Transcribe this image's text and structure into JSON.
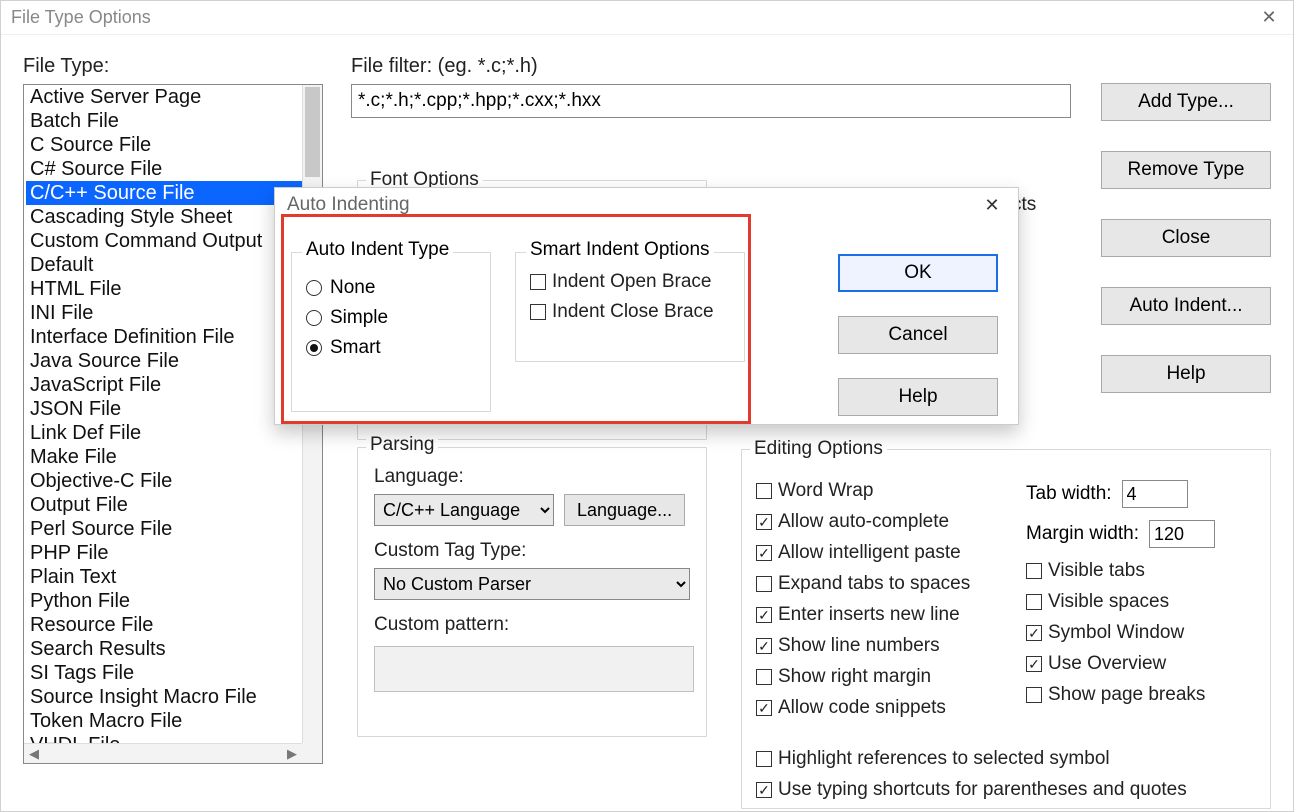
{
  "window": {
    "title": "File Type Options"
  },
  "file_type": {
    "label": "File Type:",
    "selected_index": 4,
    "items": [
      "Active Server Page",
      "Batch File",
      "C Source File",
      "C# Source File",
      "C/C++ Source File",
      "Cascading Style Sheet",
      "Custom Command Output",
      "Default",
      "HTML File",
      "INI File",
      "Interface Definition File",
      "Java Source File",
      "JavaScript File",
      "JSON File",
      "Link Def File",
      "Make File",
      "Objective-C File",
      "Output File",
      "Perl Source File",
      "PHP File",
      "Plain Text",
      "Python File",
      "Resource File",
      "Search Results",
      "SI Tags File",
      "Source Insight Macro File",
      "Token Macro File",
      "VHDL File"
    ]
  },
  "filter": {
    "label": "File filter: (eg. *.c;*.h)",
    "value": "*.c;*.h;*.cpp;*.hpp;*.cxx;*.hxx"
  },
  "font_options": {
    "label": "Font Options"
  },
  "include_projects": {
    "label": "Include when adding to projects",
    "checked": true
  },
  "parsing": {
    "label": "Parsing",
    "language_label": "Language:",
    "language_value": "C/C++ Language",
    "language_btn": "Language...",
    "custom_tag_label": "Custom Tag Type:",
    "custom_tag_value": "No Custom Parser",
    "custom_pattern_label": "Custom pattern:"
  },
  "editing": {
    "label": "Editing Options",
    "tab_width_label": "Tab width:",
    "tab_width_value": "4",
    "margin_width_label": "Margin width:",
    "margin_width_value": "120",
    "opts_a": [
      {
        "label": "Word Wrap",
        "checked": false
      },
      {
        "label": "Allow auto-complete",
        "checked": true
      },
      {
        "label": "Allow intelligent paste",
        "checked": true
      },
      {
        "label": "Expand tabs to spaces",
        "checked": false
      },
      {
        "label": "Enter inserts new line",
        "checked": true
      },
      {
        "label": "Show line numbers",
        "checked": true
      },
      {
        "label": "Show right margin",
        "checked": false
      },
      {
        "label": "Allow code snippets",
        "checked": true
      }
    ],
    "opts_b": [
      {
        "label": "Visible tabs",
        "checked": false
      },
      {
        "label": "Visible spaces",
        "checked": false
      },
      {
        "label": "Symbol Window",
        "checked": true
      },
      {
        "label": "Use Overview",
        "checked": true
      },
      {
        "label": "Show page breaks",
        "checked": false
      }
    ],
    "wide": [
      {
        "label": "Highlight references to selected symbol",
        "checked": false
      },
      {
        "label": "Use typing shortcuts for parentheses and quotes",
        "checked": true
      }
    ]
  },
  "side_buttons": {
    "add": "Add Type...",
    "remove": "Remove Type",
    "close": "Close",
    "auto_indent": "Auto Indent...",
    "help": "Help"
  },
  "auto_indent": {
    "title": "Auto Indenting",
    "type_group": "Auto Indent Type",
    "smart_group": "Smart Indent Options",
    "radios": [
      {
        "label": "None"
      },
      {
        "label": "Simple"
      },
      {
        "label": "Smart"
      }
    ],
    "radio_selected": 2,
    "smart_checks": [
      {
        "label": "Indent Open Brace",
        "checked": false
      },
      {
        "label": "Indent Close Brace",
        "checked": false
      }
    ],
    "ok": "OK",
    "cancel": "Cancel",
    "help": "Help"
  }
}
